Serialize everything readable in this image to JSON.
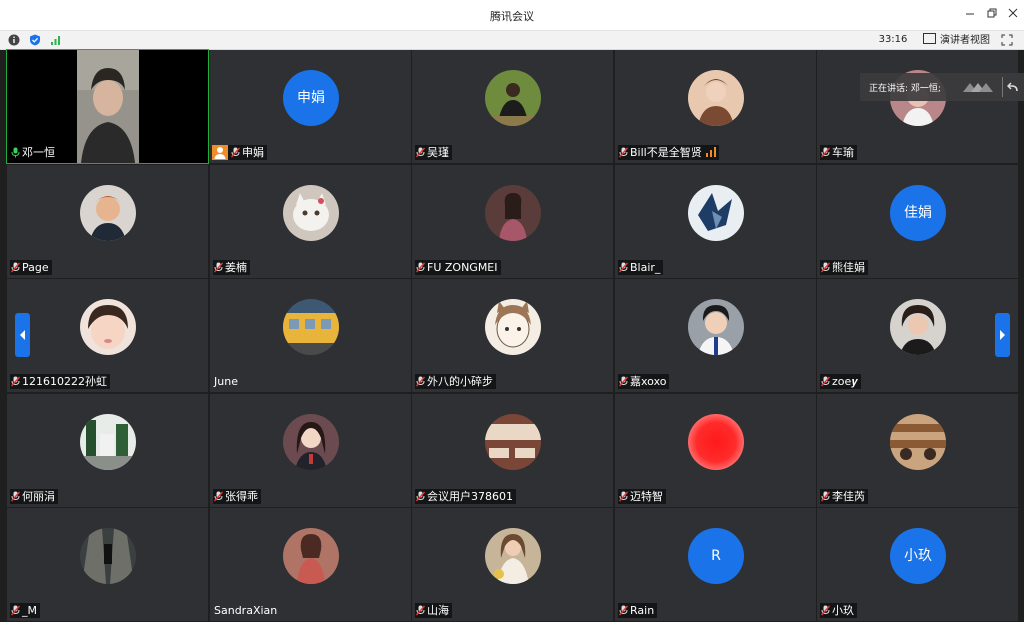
{
  "window": {
    "title": "腾讯会议"
  },
  "toolbar": {
    "timer": "33:16",
    "presenter_view": "演讲者视图"
  },
  "speaking": {
    "text": "正在讲话: 邓一恒;"
  },
  "colors": {
    "accent": "#1a73e8",
    "tile_bg": "#2e3033",
    "host_badge": "#f28c28",
    "red_avatar": "#ff2020"
  },
  "participants": [
    {
      "name": "邓一恒"
    },
    {
      "name": "申娟",
      "avatar_text": "申娟"
    },
    {
      "name": "吴瑾"
    },
    {
      "name": "Bill不是全智贤"
    },
    {
      "name": "车瑜"
    },
    {
      "name": "Page"
    },
    {
      "name": "姜楠"
    },
    {
      "name": "FU ZONGMEI"
    },
    {
      "name": "Blair_"
    },
    {
      "name": "熊佳娟",
      "avatar_text": "佳娟"
    },
    {
      "name": "121610222孙虹"
    },
    {
      "name": "June"
    },
    {
      "name": "外八的小碎步"
    },
    {
      "name": "嘉xoxo"
    },
    {
      "name": "zoe𝒚"
    },
    {
      "name": "何丽涓"
    },
    {
      "name": "张得乖"
    },
    {
      "name": "会议用户378601"
    },
    {
      "name": "迈特智"
    },
    {
      "name": "李佳芮"
    },
    {
      "name": "_M"
    },
    {
      "name": "SandraXian"
    },
    {
      "name": "山海"
    },
    {
      "name": "Rain",
      "avatar_text": "R"
    },
    {
      "name": "小玖",
      "avatar_text": "小玖"
    }
  ]
}
